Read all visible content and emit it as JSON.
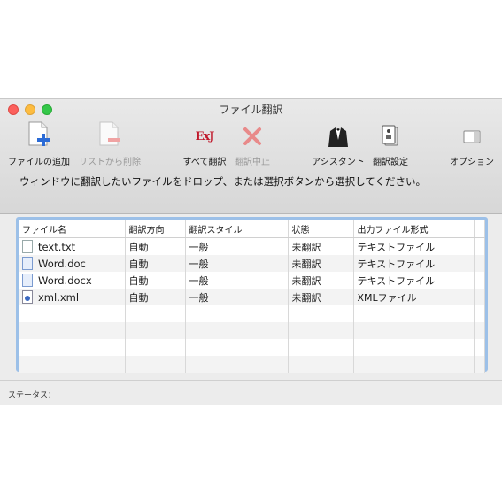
{
  "window": {
    "title": "ファイル翻訳"
  },
  "toolbar": {
    "add_file": "ファイルの追加",
    "remove_from_list": "リストから削除",
    "translate_all": "すべて翻訳",
    "translate_all_icon_text": "ExJ",
    "stop_translation": "翻訳中止",
    "assistant": "アシスタント",
    "translation_settings": "翻訳設定",
    "options": "オプション"
  },
  "instruction": "ウィンドウに翻訳したいファイルをドロップ、または選択ボタンから選択してください。",
  "table": {
    "headers": [
      "ファイル名",
      "翻訳方向",
      "翻訳スタイル",
      "状態",
      "出力ファイル形式"
    ],
    "rows": [
      {
        "icon": "text-file-icon",
        "file": "text.txt",
        "direction": "自動",
        "style": "一般",
        "status": "未翻訳",
        "format": "テキストファイル"
      },
      {
        "icon": "word-file-icon",
        "file": "Word.doc",
        "direction": "自動",
        "style": "一般",
        "status": "未翻訳",
        "format": "テキストファイル"
      },
      {
        "icon": "word-file-icon",
        "file": "Word.docx",
        "direction": "自動",
        "style": "一般",
        "status": "未翻訳",
        "format": "テキストファイル"
      },
      {
        "icon": "xml-file-icon",
        "file": "xml.xml",
        "direction": "自動",
        "style": "一般",
        "status": "未翻訳",
        "format": "XMLファイル"
      }
    ]
  },
  "status": {
    "label": "ステータス："
  },
  "colors": {
    "table_focus_border": "#9cc0e8",
    "close": "#fc605c",
    "minimize": "#fdbc40",
    "maximize": "#34c749"
  }
}
